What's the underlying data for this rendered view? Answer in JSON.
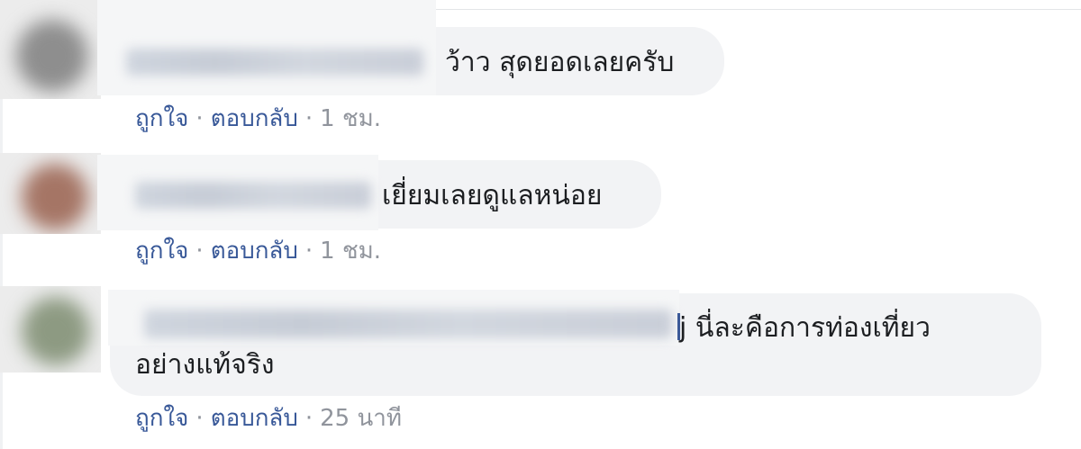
{
  "comments": [
    {
      "text": "ว้าว สุดยอดเลยครับ",
      "actions": {
        "like": "ถูกใจ",
        "reply": "ตอบกลับ",
        "separator": "·",
        "time": "1 ชม."
      },
      "avatar_color": "#9a9a9a"
    },
    {
      "text": "เยี่ยมเลยดูแลหน่อย",
      "actions": {
        "like": "ถูกใจ",
        "reply": "ตอบกลับ",
        "separator": "·",
        "time": "1 ชม."
      },
      "avatar_color": "#a87a6a"
    },
    {
      "text": "j นี่ละคือการท่องเที่ยว",
      "text_line2": "อย่างแท้จริง",
      "actions": {
        "like": "ถูกใจ",
        "reply": "ตอบกลับ",
        "separator": "·",
        "time": "25 นาที"
      },
      "avatar_color": "#8f9b83"
    }
  ],
  "colors": {
    "bubble": "#f2f3f5",
    "link": "#385898",
    "meta": "#90949c",
    "text": "#1c1e21"
  }
}
